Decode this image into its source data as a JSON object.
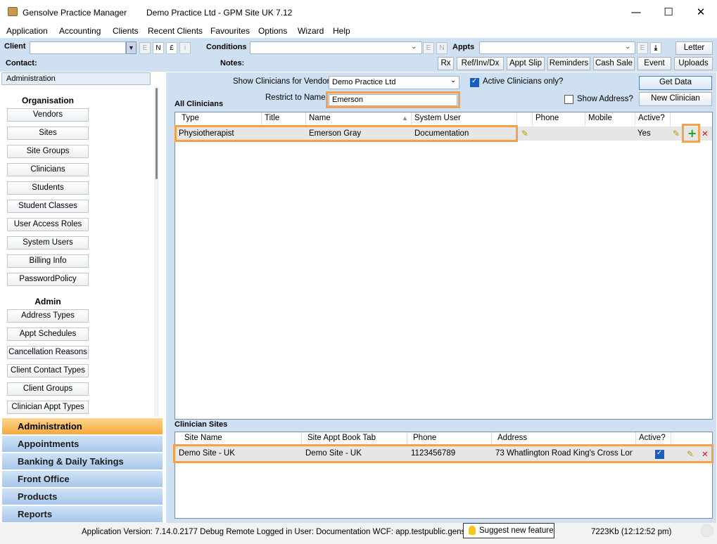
{
  "window": {
    "app_title": "Gensolve Practice Manager",
    "practice_title": "Demo Practice Ltd - GPM Site UK 7.12",
    "minimize": "—",
    "maximize": "☐",
    "close": "✕"
  },
  "menu": [
    "Application",
    "Accounting",
    "Clients",
    "Recent Clients",
    "Favourites",
    "Options",
    "Wizard",
    "Help"
  ],
  "toolbar": {
    "client_label": "Client",
    "client_value": "",
    "btn_e": "E",
    "btn_n": "N",
    "btn_pound": "£",
    "btn_i": "i",
    "conditions_label": "Conditions",
    "conditions_value": "",
    "cond_e": "E",
    "cond_n": "N",
    "appts_label": "Appts",
    "appts_value": "",
    "appts_e": "E",
    "appts_download": "⤓",
    "letter": "Letter",
    "contact_label": "Contact:",
    "notes_label": "Notes:",
    "rx": "Rx",
    "refinvdx": "Ref/Inv/Dx",
    "appt_slip": "Appt Slip",
    "reminders": "Reminders",
    "cash_sale": "Cash Sale",
    "event": "Event",
    "uploads": "Uploads"
  },
  "sidebar": {
    "header": "Administration",
    "org_title": "Organisation",
    "org_items": [
      "Vendors",
      "Sites",
      "Site Groups",
      "Clinicians",
      "Students",
      "Student Classes",
      "User Access Roles",
      "System Users",
      "Billing Info",
      "PasswordPolicy"
    ],
    "admin_title": "Admin",
    "admin_items": [
      "Address Types",
      "Appt Schedules",
      "Cancellation Reasons",
      "Client Contact Types",
      "Client Groups",
      "Clinician Appt Types"
    ],
    "nav": [
      "Administration",
      "Appointments",
      "Banking & Daily Takings",
      "Front Office",
      "Products",
      "Reports"
    ]
  },
  "filters": {
    "vendor_label": "Show Clinicians for Vendor",
    "vendor_value": "Demo Practice Ltd",
    "active_only_label": "Active Clinicians only?",
    "active_only_checked": true,
    "restrict_label": "Restrict to Name",
    "restrict_value": "Emerson",
    "show_address_label": "Show Address?",
    "show_address_checked": false,
    "get_data": "Get Data",
    "new_clinician": "New Clinician"
  },
  "clinicians": {
    "title": "All Clinicians",
    "columns": [
      "Type",
      "Title",
      "Name",
      "System User",
      "",
      "Phone",
      "Mobile",
      "Active?"
    ],
    "rows": [
      {
        "type": "Physiotherapist",
        "title": "",
        "name": "Emerson Gray",
        "system_user": "Documentation",
        "phone": "",
        "mobile": "",
        "active": "Yes"
      }
    ]
  },
  "sites": {
    "title": "Clinician Sites",
    "columns": [
      "Site Name",
      "Site Appt Book Tab",
      "Phone",
      "Address",
      "Active?"
    ],
    "rows": [
      {
        "site_name": "Demo Site - UK",
        "tab": "Demo Site - UK",
        "phone": "1123456789",
        "address": "73 Whatlington Road King's Cross Lon...",
        "active": true
      }
    ]
  },
  "status": {
    "version": "Application Version: 7.14.0.2177 Debug Remote  Logged in User: Documentation WCF: app.testpublic.gensolve.co",
    "suggest": "Suggest new feature",
    "memory": "7223Kb  (12:12:52 pm)"
  },
  "colors": {
    "accent": "#f4a24a",
    "toolbar_bg": "#cfe0f3",
    "nav_active": "#f6a93c"
  }
}
